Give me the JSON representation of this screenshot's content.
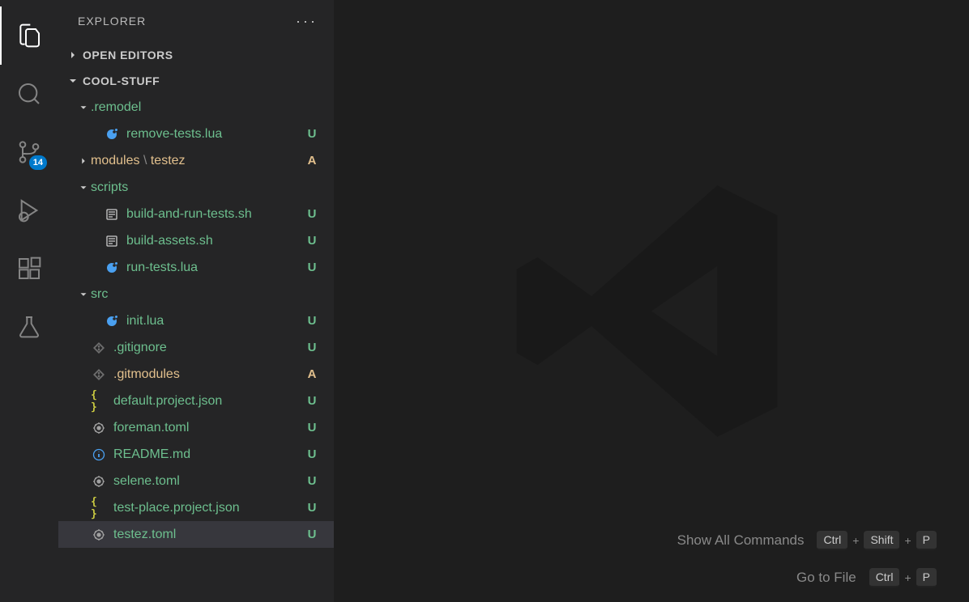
{
  "sidebar": {
    "title": "EXPLORER",
    "sections": {
      "openEditors": "OPEN EDITORS",
      "workspace": "COOL-STUFF"
    }
  },
  "tree": [
    {
      "id": "remodel",
      "label": ".remodel",
      "indent": 1,
      "expandable": true,
      "expanded": true,
      "icon": "folder-open",
      "color": "green",
      "status": "",
      "statusDot": true
    },
    {
      "id": "remove-tests",
      "label": "remove-tests.lua",
      "indent": 2,
      "expandable": false,
      "icon": "lua",
      "color": "green",
      "status": "U"
    },
    {
      "id": "modules",
      "label": "modules",
      "label2": "testez",
      "indent": 1,
      "expandable": true,
      "expanded": false,
      "icon": "folder",
      "color": "orange",
      "status": "A"
    },
    {
      "id": "scripts",
      "label": "scripts",
      "indent": 1,
      "expandable": true,
      "expanded": true,
      "icon": "folder-open",
      "color": "green",
      "status": "",
      "statusDot": true
    },
    {
      "id": "build-and-run",
      "label": "build-and-run-tests.sh",
      "indent": 2,
      "expandable": false,
      "icon": "sh",
      "color": "green",
      "status": "U"
    },
    {
      "id": "build-assets",
      "label": "build-assets.sh",
      "indent": 2,
      "expandable": false,
      "icon": "sh",
      "color": "green",
      "status": "U"
    },
    {
      "id": "run-tests",
      "label": "run-tests.lua",
      "indent": 2,
      "expandable": false,
      "icon": "lua",
      "color": "green",
      "status": "U"
    },
    {
      "id": "src",
      "label": "src",
      "indent": 1,
      "expandable": true,
      "expanded": true,
      "icon": "folder-open",
      "color": "green",
      "status": "",
      "statusDot": true
    },
    {
      "id": "init",
      "label": "init.lua",
      "indent": 2,
      "expandable": false,
      "icon": "lua",
      "color": "green",
      "status": "U"
    },
    {
      "id": "gitignore",
      "label": ".gitignore",
      "indent": 1,
      "expandable": false,
      "icon": "git",
      "color": "green",
      "status": "U"
    },
    {
      "id": "gitmodules",
      "label": ".gitmodules",
      "indent": 1,
      "expandable": false,
      "icon": "git",
      "color": "orange",
      "status": "A"
    },
    {
      "id": "default-json",
      "label": "default.project.json",
      "indent": 1,
      "expandable": false,
      "icon": "json",
      "color": "green",
      "status": "U"
    },
    {
      "id": "foreman",
      "label": "foreman.toml",
      "indent": 1,
      "expandable": false,
      "icon": "toml",
      "color": "green",
      "status": "U"
    },
    {
      "id": "readme",
      "label": "README.md",
      "indent": 1,
      "expandable": false,
      "icon": "info",
      "color": "green",
      "status": "U"
    },
    {
      "id": "selene",
      "label": "selene.toml",
      "indent": 1,
      "expandable": false,
      "icon": "toml",
      "color": "green",
      "status": "U"
    },
    {
      "id": "test-place",
      "label": "test-place.project.json",
      "indent": 1,
      "expandable": false,
      "icon": "json",
      "color": "green",
      "status": "U"
    },
    {
      "id": "testez",
      "label": "testez.toml",
      "indent": 1,
      "expandable": false,
      "icon": "toml",
      "color": "green",
      "status": "U",
      "selected": true
    }
  ],
  "scm": {
    "badge": "14"
  },
  "shortcuts": [
    {
      "label": "Show All Commands",
      "keys": [
        "Ctrl",
        "Shift",
        "P"
      ]
    },
    {
      "label": "Go to File",
      "keys": [
        "Ctrl",
        "P"
      ]
    }
  ]
}
